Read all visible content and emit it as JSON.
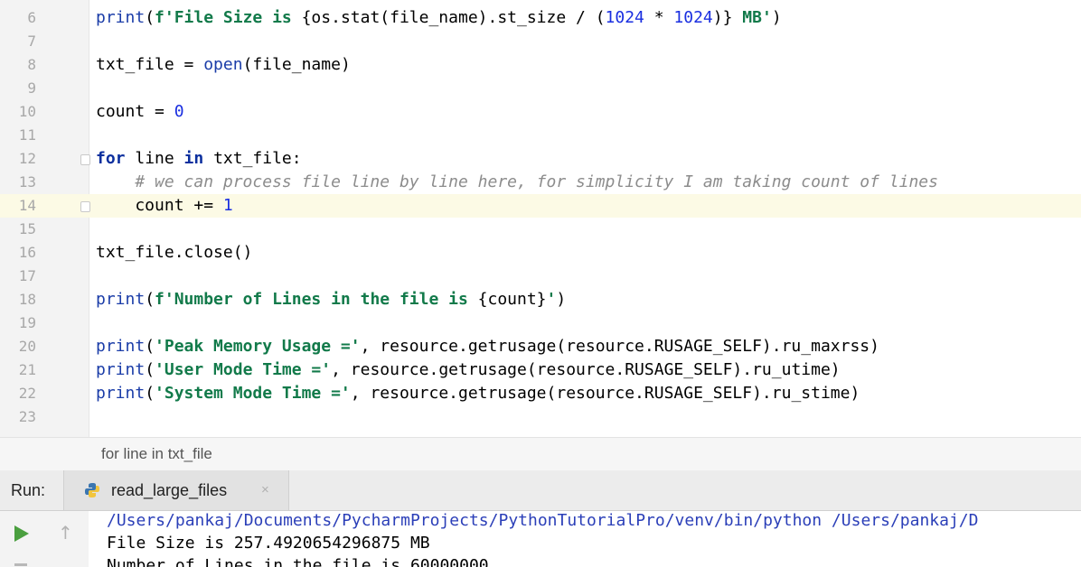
{
  "editor": {
    "lines": [
      {
        "n": "6",
        "tokens": [
          {
            "t": "print",
            "c": "fn"
          },
          {
            "t": "(",
            "c": "plain"
          },
          {
            "t": "f'File Size is ",
            "c": "str"
          },
          {
            "t": "{os.stat(file_name).st_size / (",
            "c": "plain"
          },
          {
            "t": "1024",
            "c": "num"
          },
          {
            "t": " * ",
            "c": "plain"
          },
          {
            "t": "1024",
            "c": "num"
          },
          {
            "t": ")}",
            "c": "plain"
          },
          {
            "t": " MB'",
            "c": "str"
          },
          {
            "t": ")",
            "c": "plain"
          }
        ]
      },
      {
        "n": "7",
        "tokens": []
      },
      {
        "n": "8",
        "tokens": [
          {
            "t": "txt_file = ",
            "c": "plain"
          },
          {
            "t": "open",
            "c": "fn"
          },
          {
            "t": "(file_name)",
            "c": "plain"
          }
        ]
      },
      {
        "n": "9",
        "tokens": []
      },
      {
        "n": "10",
        "tokens": [
          {
            "t": "count = ",
            "c": "plain"
          },
          {
            "t": "0",
            "c": "num"
          }
        ]
      },
      {
        "n": "11",
        "tokens": []
      },
      {
        "n": "12",
        "tokens": [
          {
            "t": "for",
            "c": "kw"
          },
          {
            "t": " line ",
            "c": "plain"
          },
          {
            "t": "in",
            "c": "kw"
          },
          {
            "t": " txt_file:",
            "c": "plain"
          }
        ]
      },
      {
        "n": "13",
        "tokens": [
          {
            "t": "    # we can process file line by line here, for simplicity I am taking count of lines",
            "c": "cmt"
          }
        ]
      },
      {
        "n": "14",
        "tokens": [
          {
            "t": "    count += ",
            "c": "plain"
          },
          {
            "t": "1",
            "c": "num"
          }
        ]
      },
      {
        "n": "15",
        "tokens": []
      },
      {
        "n": "16",
        "tokens": [
          {
            "t": "txt_file.close()",
            "c": "plain"
          }
        ]
      },
      {
        "n": "17",
        "tokens": []
      },
      {
        "n": "18",
        "tokens": [
          {
            "t": "print",
            "c": "fn"
          },
          {
            "t": "(",
            "c": "plain"
          },
          {
            "t": "f'Number of Lines in the file is ",
            "c": "str"
          },
          {
            "t": "{count}",
            "c": "plain"
          },
          {
            "t": "'",
            "c": "str"
          },
          {
            "t": ")",
            "c": "plain"
          }
        ]
      },
      {
        "n": "19",
        "tokens": []
      },
      {
        "n": "20",
        "tokens": [
          {
            "t": "print",
            "c": "fn"
          },
          {
            "t": "(",
            "c": "plain"
          },
          {
            "t": "'Peak Memory Usage ='",
            "c": "str"
          },
          {
            "t": ", resource.getrusage(resource.RUSAGE_SELF).ru_maxrss)",
            "c": "plain"
          }
        ]
      },
      {
        "n": "21",
        "tokens": [
          {
            "t": "print",
            "c": "fn"
          },
          {
            "t": "(",
            "c": "plain"
          },
          {
            "t": "'User Mode Time ='",
            "c": "str"
          },
          {
            "t": ", resource.getrusage(resource.RUSAGE_SELF).ru_utime)",
            "c": "plain"
          }
        ]
      },
      {
        "n": "22",
        "tokens": [
          {
            "t": "print",
            "c": "fn"
          },
          {
            "t": "(",
            "c": "plain"
          },
          {
            "t": "'System Mode Time ='",
            "c": "str"
          },
          {
            "t": ", resource.getrusage(resource.RUSAGE_SELF).ru_stime)",
            "c": "plain"
          }
        ]
      },
      {
        "n": "23",
        "tokens": []
      }
    ],
    "current_line": "14"
  },
  "breadcrumb": {
    "text": "for line in txt_file"
  },
  "run": {
    "label": "Run:",
    "tab_name": "read_large_files",
    "tab_close": "×",
    "up_glyph": "↑",
    "icon": "python-icon",
    "output": [
      {
        "text": "/Users/pankaj/Documents/PycharmProjects/PythonTutorialPro/venv/bin/python /Users/pankaj/D",
        "color": "#2b3fb8"
      },
      {
        "text": "File Size is 257.4920654296875 MB",
        "color": "#000000"
      },
      {
        "text": "Number of Lines in the file is 60000000",
        "color": "#000000"
      }
    ]
  }
}
